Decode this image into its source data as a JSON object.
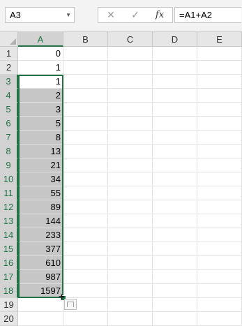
{
  "name_box": {
    "value": "A3"
  },
  "formula_bar": {
    "cancel_icon": "x-icon",
    "enter_icon": "check-icon",
    "function_icon": "fx",
    "value": "=A1+A2"
  },
  "columns": [
    "A",
    "B",
    "C",
    "D",
    "E"
  ],
  "rows": [
    {
      "num": "1",
      "a": "0"
    },
    {
      "num": "2",
      "a": "1"
    },
    {
      "num": "3",
      "a": "1"
    },
    {
      "num": "4",
      "a": "2"
    },
    {
      "num": "5",
      "a": "3"
    },
    {
      "num": "6",
      "a": "5"
    },
    {
      "num": "7",
      "a": "8"
    },
    {
      "num": "8",
      "a": "13"
    },
    {
      "num": "9",
      "a": "21"
    },
    {
      "num": "10",
      "a": "34"
    },
    {
      "num": "11",
      "a": "55"
    },
    {
      "num": "12",
      "a": "89"
    },
    {
      "num": "13",
      "a": "144"
    },
    {
      "num": "14",
      "a": "233"
    },
    {
      "num": "15",
      "a": "377"
    },
    {
      "num": "16",
      "a": "610"
    },
    {
      "num": "17",
      "a": "987"
    },
    {
      "num": "18",
      "a": "1597"
    },
    {
      "num": "19",
      "a": ""
    },
    {
      "num": "20",
      "a": ""
    }
  ],
  "selection": {
    "range": "A3:A18",
    "active_cell": "A3"
  },
  "colors": {
    "accent": "#217346",
    "selection": "#c6c6c6",
    "header": "#e6e6e6"
  }
}
